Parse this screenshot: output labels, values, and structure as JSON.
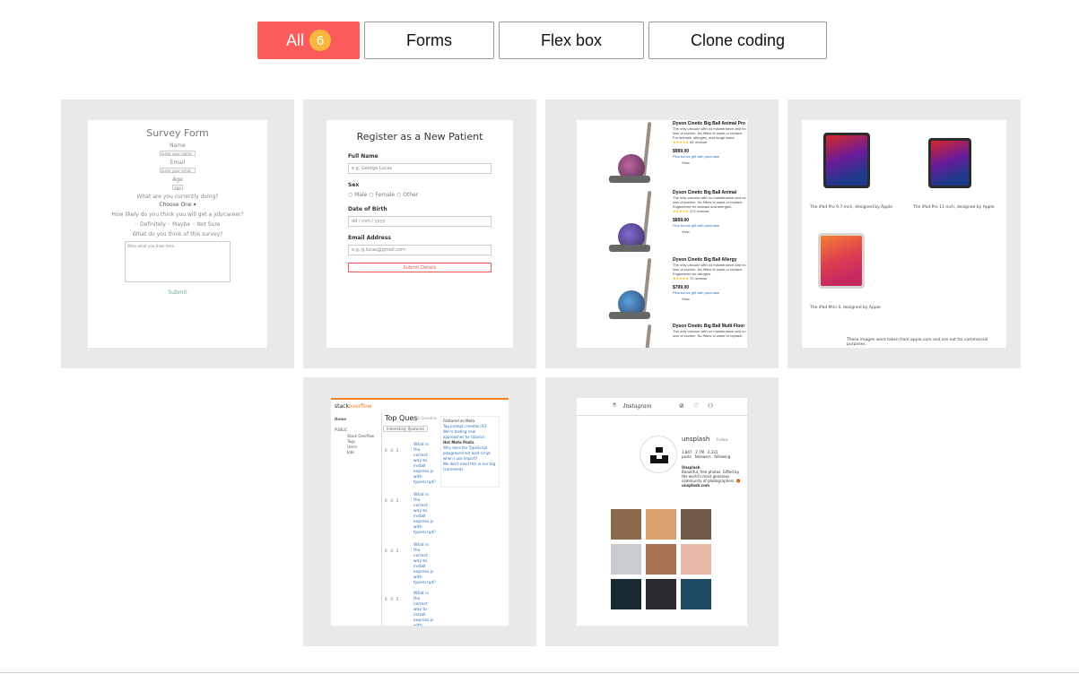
{
  "filters": {
    "all_label": "All",
    "all_count": "6",
    "forms_label": "Forms",
    "flexbox_label": "Flex box",
    "clone_label": "Clone coding"
  },
  "projects": {
    "survey": {
      "title": "Survey Form",
      "name_label": "Name",
      "name_placeholder": "Enter your name",
      "email_label": "Email",
      "email_placeholder": "Enter your email",
      "age_label": "Age",
      "age_placeholder": "Age",
      "doing_label": "What are you currently doing?",
      "doing_value": "Choose One ▾",
      "likely_label": "How likely do you think you will get a job/career?",
      "likely_options": "◦ Definitely ◦ Maybe ◦ Not Sure",
      "think_label": "What do you think of this survey?",
      "textarea_placeholder": "Write what you think here...",
      "submit": "Submit"
    },
    "register": {
      "title": "Register as a New Patient",
      "fullname_label": "Full Name",
      "fullname_placeholder": "e.g. George Lucas",
      "sex_label": "Sex",
      "sex_options": "○ Male  ○ Female  ○ Other",
      "dob_label": "Date of Birth",
      "dob_placeholder": "dd / mm / yyyy",
      "email_label": "Email Address",
      "email_placeholder": "e.g. g.lucas@gmail.com",
      "submit": "Submit Details"
    },
    "dyson": {
      "items": [
        {
          "name": "Dyson Cinetic Big Ball Animal Pro",
          "desc": "The only vacuum with no maintenance and no loss of suction. No filters to wash or replace.",
          "sub": "For animals, allergies, and tough tasks.",
          "stars": "★★★★★",
          "reviews": "64 reviews",
          "price": "$999.00",
          "offer": "Plus bonus gift with purchase",
          "btn": "View"
        },
        {
          "name": "Dyson Cinetic Big Ball Animal",
          "desc": "The only vacuum with no maintenance and no loss of suction. No filters to wash or replace.",
          "sub": "Engineered for animals and allergies.",
          "stars": "★★★★★",
          "reviews": "272 reviews",
          "price": "$899.00",
          "offer": "Plus bonus gift with purchase",
          "btn": "View"
        },
        {
          "name": "Dyson Cinetic Big Ball Allergy",
          "desc": "The only vacuum with no maintenance and no loss of suction. No filters to wash or replace.",
          "sub": "Engineered for allergies.",
          "stars": "★★★★★",
          "reviews": "70 reviews",
          "price": "$799.00",
          "offer": "Plus bonus gift with purchase",
          "btn": "View"
        },
        {
          "name": "Dyson Cinetic Big Ball Multi Floor",
          "desc": "The only vacuum with no maintenance and no loss of suction. No filters to wash or replace.",
          "sub": "",
          "stars": "",
          "reviews": "",
          "price": "",
          "offer": "",
          "btn": ""
        }
      ]
    },
    "ipad": {
      "caption_1": "The iPad Pro 9.7-inch, designed by Apple",
      "caption_2": "The iPad Pro 11-inch, designed by Apple",
      "caption_3": "The iPad Mini 4, designed by Apple",
      "footer": "These images were taken from apple.com and are not for commercial purposes."
    },
    "stackoverflow": {
      "logo_prefix": "stack",
      "logo_suffix": "overflow",
      "page_title": "Top Ques",
      "page_sub": "Ask Question",
      "nav_home": "Home",
      "nav_public": "PUBLIC",
      "nav_items": [
        "Stack Overflow",
        "Tags",
        "Users",
        "Jobs"
      ],
      "tab_1": "Interesting",
      "tab_2": "Featured",
      "stats": [
        "0",
        "0",
        "2"
      ],
      "stat_labels": [
        "votes",
        "answers",
        "views"
      ],
      "question_title": "What is the correct way to install express.js with typescript?",
      "panel_title": "Featured on Meta",
      "panel_link_1": "Tag prompt: mention R3",
      "panel_link_2": "We're testing new approaches for tutorial",
      "panel_hot": "Hot Meta Posts",
      "panel_items": [
        "Why does the TypeScript playground not load script when I use import?",
        "We don't need this in our tag (comment)",
        "Is there not a close this answer?",
        "Why do the specific TSmi moved support when to assemble answer display?"
      ]
    },
    "instagram": {
      "brand": "Instagram",
      "username": "unsplash",
      "follow": "Follow",
      "posts_count": "3,847",
      "posts_label": "posts",
      "followers_count": "2.7M",
      "followers_label": "followers",
      "following_count": "2,331",
      "following_label": "following",
      "bio_name": "Unsplash",
      "bio_text": "Beautiful, free photos. Gifted by the world's most generous community of photographers. 🎁",
      "bio_link": "unsplash.com",
      "tile_colors": [
        "#8a6a4a",
        "#d9a070",
        "#6f5a4a",
        "#c8ccd0",
        "#a87050",
        "#e8b8a8",
        "#1a2a33",
        "#2a2a30",
        "#1f4a66"
      ]
    }
  }
}
